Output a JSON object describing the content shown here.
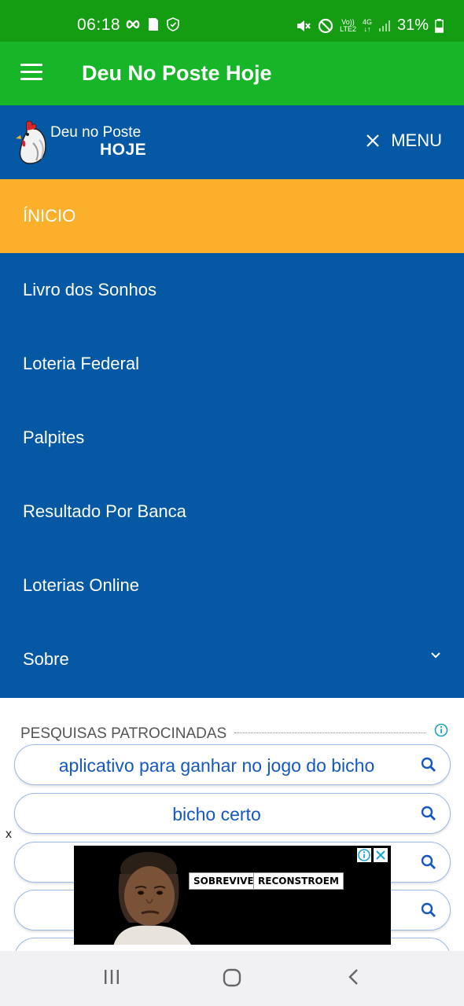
{
  "status_bar": {
    "time": "06:18",
    "battery": "31%",
    "icons": [
      "infinity-icon",
      "sim-card-icon",
      "shield-check-icon",
      "mute-icon",
      "do-not-disturb-icon",
      "volte-icon",
      "4g-icon",
      "signal-icon",
      "battery-icon"
    ],
    "volte_top": "Vo))",
    "volte_bottom": "LTE2",
    "net_type": "4G"
  },
  "app_bar": {
    "title": "Deu No Poste Hoje"
  },
  "site_header": {
    "logo_line1": "Deu no Poste",
    "logo_line2": "HOJE",
    "menu_label": "MENU"
  },
  "nav": {
    "items": [
      {
        "label": "ÍNICIO",
        "active": true
      },
      {
        "label": "Livro dos Sonhos"
      },
      {
        "label": "Loteria Federal"
      },
      {
        "label": "Palpites"
      },
      {
        "label": "Resultado Por Banca"
      },
      {
        "label": "Loterias Online"
      },
      {
        "label": "Sobre",
        "has_submenu": true
      }
    ]
  },
  "ads": {
    "label": "PESQUISAS PATROCINADAS",
    "searches": [
      {
        "text": "aplicativo para ganhar no jogo do bicho"
      },
      {
        "text": "bicho certo"
      },
      {
        "text": ""
      },
      {
        "text": ""
      },
      {
        "text": ""
      }
    ],
    "close_label": "x",
    "banner_tags": [
      "SOBREVIVEM",
      "RECONSTROEM"
    ]
  },
  "colors": {
    "status_bar": "#149d12",
    "app_bar": "#16b628",
    "site_blue": "#0558a3",
    "active_orange": "#fbaf2b",
    "ad_link_blue": "#1558c2"
  }
}
